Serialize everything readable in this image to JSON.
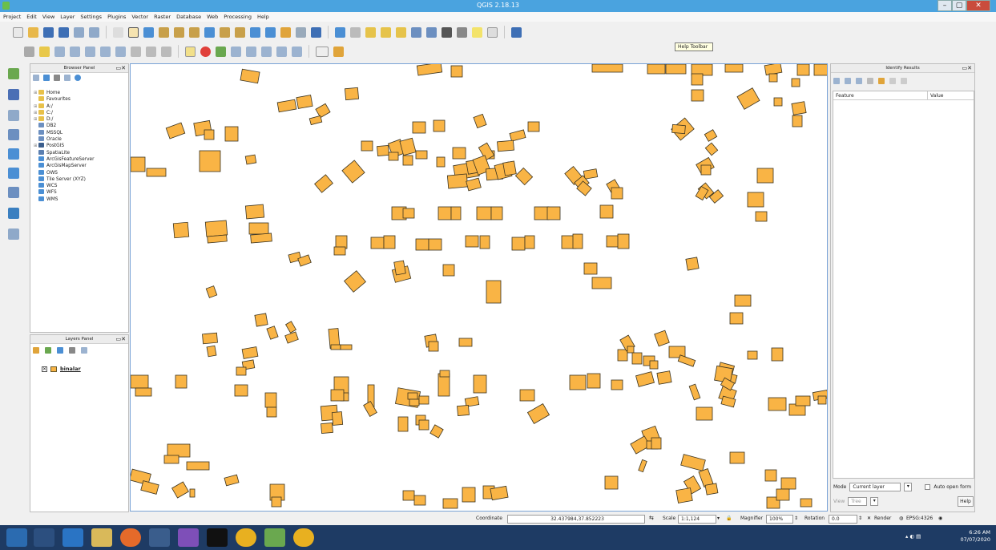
{
  "window": {
    "title": "QGIS 2.18.13",
    "minimize": "–",
    "maximize": "▢",
    "close": "✕"
  },
  "menu": [
    "Project",
    "Edit",
    "View",
    "Layer",
    "Settings",
    "Plugins",
    "Vector",
    "Raster",
    "Database",
    "Web",
    "Processing",
    "Help"
  ],
  "tooltip": "Help Toolbar",
  "browser_panel": {
    "title": "Browser Panel",
    "items": [
      {
        "label": "Home",
        "icon": "folder-icon",
        "expandable": true
      },
      {
        "label": "Favourites",
        "icon": "star-icon",
        "expandable": false
      },
      {
        "label": "A:/",
        "icon": "folder-icon",
        "expandable": true
      },
      {
        "label": "C:/",
        "icon": "folder-icon",
        "expandable": true
      },
      {
        "label": "D:/",
        "icon": "folder-icon",
        "expandable": true
      },
      {
        "label": "DB2",
        "icon": "database-icon",
        "expandable": false
      },
      {
        "label": "MSSQL",
        "icon": "database-icon",
        "expandable": false
      },
      {
        "label": "Oracle",
        "icon": "database-icon",
        "expandable": false
      },
      {
        "label": "PostGIS",
        "icon": "elephant-icon",
        "expandable": true
      },
      {
        "label": "SpatiaLite",
        "icon": "feather-icon",
        "expandable": false
      },
      {
        "label": "ArcGisFeatureServer",
        "icon": "globe-icon",
        "expandable": false
      },
      {
        "label": "ArcGisMapServer",
        "icon": "globe-icon",
        "expandable": false
      },
      {
        "label": "OWS",
        "icon": "globe-icon",
        "expandable": false
      },
      {
        "label": "Tile Server (XYZ)",
        "icon": "globe-icon",
        "expandable": false
      },
      {
        "label": "WCS",
        "icon": "globe-icon",
        "expandable": false
      },
      {
        "label": "WFS",
        "icon": "globe-icon",
        "expandable": false
      },
      {
        "label": "WMS",
        "icon": "globe-icon",
        "expandable": false
      }
    ]
  },
  "layers_panel": {
    "title": "Layers Panel",
    "layers": [
      {
        "name": "binalar",
        "visible": true,
        "color": "#f9b445"
      }
    ]
  },
  "identify_panel": {
    "title": "Identify Results",
    "columns": [
      "Feature",
      "Value"
    ],
    "mode_label": "Mode",
    "mode_value": "Current layer",
    "auto_open_label": "Auto open form",
    "view_label": "View",
    "view_value": "Tree",
    "help_button": "Help"
  },
  "status": {
    "coordinate_label": "Coordinate",
    "coordinate_value": "32.437984,37.852223",
    "scale_label": "Scale",
    "scale_value": "1:1,124",
    "magnifier_label": "Magnifier",
    "magnifier_value": "100%",
    "rotation_label": "Rotation",
    "rotation_value": "0.0",
    "render_label": "Render",
    "crs": "EPSG:4326"
  },
  "taskbar": {
    "time": "6:26 AM",
    "date": "07/07/2020"
  },
  "colors": {
    "feature_fill": "#f9b445",
    "feature_stroke": "#3a3320",
    "titlebar": "#4aa3df",
    "taskbar": "#1e3b64"
  }
}
